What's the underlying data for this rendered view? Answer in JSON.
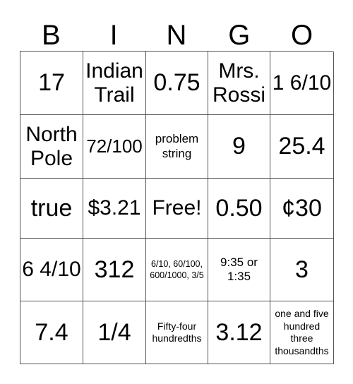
{
  "card": {
    "headers": [
      "B",
      "I",
      "N",
      "G",
      "O"
    ],
    "rows": [
      [
        {
          "text": "17",
          "size": "xl"
        },
        {
          "text": "Indian Trail",
          "size": "lg"
        },
        {
          "text": "0.75",
          "size": "xl"
        },
        {
          "text": "Mrs. Rossi",
          "size": "lg"
        },
        {
          "text": "1 6/10",
          "size": "lg"
        }
      ],
      [
        {
          "text": "North Pole",
          "size": "lg"
        },
        {
          "text": "72/100",
          "size": "md"
        },
        {
          "text": "problem string",
          "size": "sm"
        },
        {
          "text": "9",
          "size": "xl"
        },
        {
          "text": "25.4",
          "size": "xl"
        }
      ],
      [
        {
          "text": "true",
          "size": "xl"
        },
        {
          "text": "$3.21",
          "size": "lg"
        },
        {
          "text": "Free!",
          "size": "lg"
        },
        {
          "text": "0.50",
          "size": "xl"
        },
        {
          "text": "¢30",
          "size": "xl"
        }
      ],
      [
        {
          "text": "6 4/10",
          "size": "lg"
        },
        {
          "text": "312",
          "size": "xl"
        },
        {
          "text": "6/10, 60/100, 600/1000, 3/5",
          "size": "xxs"
        },
        {
          "text": "9:35 or 1:35",
          "size": "sm"
        },
        {
          "text": "3",
          "size": "xl"
        }
      ],
      [
        {
          "text": "7.4",
          "size": "xl"
        },
        {
          "text": "1/4",
          "size": "xl"
        },
        {
          "text": "Fifty-four hundredths",
          "size": "xs"
        },
        {
          "text": "3.12",
          "size": "xl"
        },
        {
          "text": "one and five hundred three thousandths",
          "size": "xs"
        }
      ]
    ],
    "free_space_label": "Free!",
    "colors": {
      "background": "#ffffff",
      "border": "#555555",
      "text": "#000000"
    }
  }
}
